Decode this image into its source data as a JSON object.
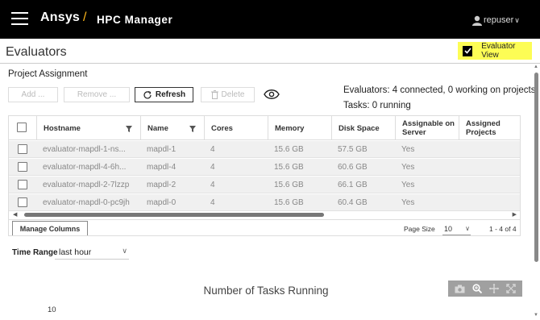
{
  "header": {
    "brand": "Ansys",
    "brand_slash": "/",
    "product": "HPC Manager",
    "user": "repuser",
    "user_chevron": "∨"
  },
  "page": {
    "title": "Evaluators",
    "evaluator_view_label": "Evaluator View",
    "evaluator_view_checked": true,
    "section_title": "Project Assignment"
  },
  "toolbar": {
    "add_label": "Add ...",
    "remove_label": "Remove ...",
    "refresh_label": "Refresh",
    "delete_label": "Delete",
    "eye_icon": "eye-icon"
  },
  "status": {
    "evaluators": "Evaluators: 4 connected, 0 working on projects",
    "tasks": "Tasks: 0 running"
  },
  "grid": {
    "columns": [
      "Hostname",
      "Name",
      "Cores",
      "Memory",
      "Disk Space",
      "Assignable on Server",
      "Assigned Projects"
    ],
    "rows": [
      [
        "evaluator-mapdl-1-ns...",
        "mapdl-1",
        "4",
        "15.6 GB",
        "57.5 GB",
        "Yes",
        ""
      ],
      [
        "evaluator-mapdl-4-6h...",
        "mapdl-4",
        "4",
        "15.6 GB",
        "60.6 GB",
        "Yes",
        ""
      ],
      [
        "evaluator-mapdl-2-7lzzp",
        "mapdl-2",
        "4",
        "15.6 GB",
        "66.1 GB",
        "Yes",
        ""
      ],
      [
        "evaluator-mapdl-0-pc9jh",
        "mapdl-0",
        "4",
        "15.6 GB",
        "60.4 GB",
        "Yes",
        ""
      ]
    ],
    "manage_columns_label": "Manage Columns",
    "page_size_label": "Page Size",
    "page_size": "10",
    "page_info": "1 - 4 of 4",
    "scroll_left": "◀",
    "scroll_right": "▶"
  },
  "time_range": {
    "label": "Time Range",
    "value": "last hour"
  },
  "chart": {
    "title": "Number of Tasks Running",
    "y_tick_top": "10"
  },
  "colors": {
    "topbar": "#000000",
    "brand_accent": "#ffb71b",
    "highlight": "#fdfd55",
    "row_bg": "#f0f0f0"
  }
}
